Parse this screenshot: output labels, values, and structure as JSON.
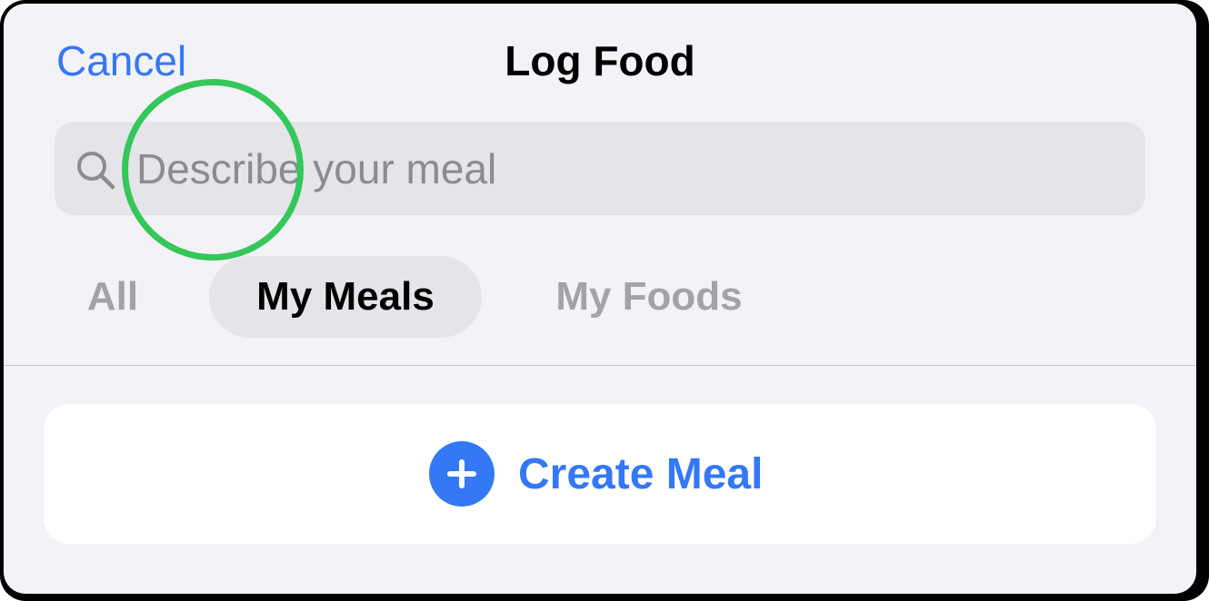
{
  "header": {
    "cancel_label": "Cancel",
    "title": "Log Food"
  },
  "search": {
    "icon": "search-icon",
    "placeholder": "Describe your meal",
    "value": ""
  },
  "tabs": [
    {
      "label": "All",
      "selected": false
    },
    {
      "label": "My Meals",
      "selected": true
    },
    {
      "label": "My Foods",
      "selected": false
    }
  ],
  "create_meal": {
    "icon": "plus-circle-icon",
    "label": "Create Meal"
  },
  "colors": {
    "accent": "#3478f6",
    "background": "#f2f2f7",
    "highlight_ring": "#34c759"
  }
}
